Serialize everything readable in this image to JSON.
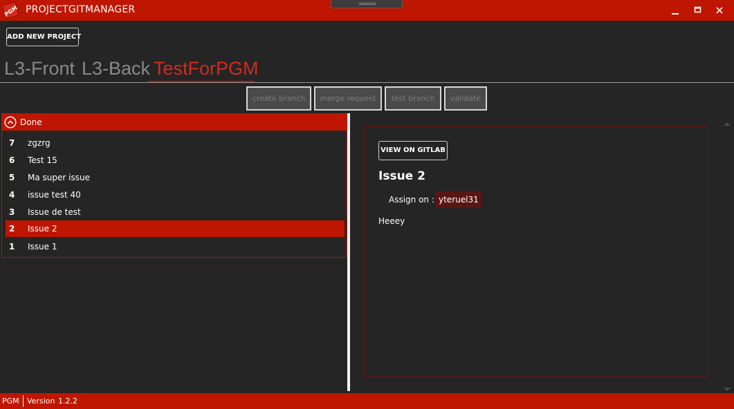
{
  "window": {
    "logo_text": "PGM",
    "title": "PROJECTGITMANAGER",
    "minimize_icon": "minimize-icon",
    "maximize_icon": "maximize-icon",
    "close_icon": "close-icon"
  },
  "toolbar": {
    "add_project_label": "ADD NEW PROJECT"
  },
  "projects": {
    "tabs": [
      "L3-Front",
      "L3-Back",
      "TestForPGM"
    ],
    "active_tab": "TestForPGM"
  },
  "actions": {
    "create_branch": "create branch",
    "merge_request": "merge request",
    "test_branch": "test branch",
    "validate": "validate"
  },
  "issues_panel": {
    "group_title": "Done",
    "group_icon": "chevron-up-circle-icon",
    "issues": [
      {
        "number": "7",
        "title": "zgzrg"
      },
      {
        "number": "6",
        "title": "Test 15"
      },
      {
        "number": "5",
        "title": "Ma super issue"
      },
      {
        "number": "4",
        "title": "issue test 40"
      },
      {
        "number": "3",
        "title": "Issue de test"
      },
      {
        "number": "2",
        "title": "Issue 2"
      },
      {
        "number": "1",
        "title": "Issue 1"
      }
    ],
    "selected_issue": "2"
  },
  "detail": {
    "view_on_gitlab_label": "VIEW ON GITLAB",
    "issue_title": "Issue 2",
    "assign_label": "Assign on :",
    "assignee": "yteruel31",
    "description": "Heeey"
  },
  "statusbar": {
    "app_name": "PGM",
    "version_label": "Version",
    "version": "1.2.2"
  },
  "colors": {
    "accent": "#be1600",
    "background": "#252525",
    "tab_active": "#d42a1c",
    "tab_inactive": "#8a8a8a"
  }
}
